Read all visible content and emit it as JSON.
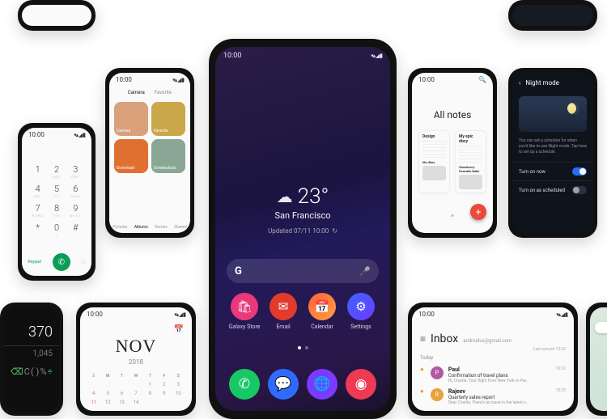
{
  "status_time": "10:00",
  "signal_glyph": "▾▴ ◢ ▮",
  "main": {
    "weather": {
      "icon": "☁",
      "temp": "23°",
      "city": "San Francisco",
      "updated_label": "Updated 07/11 10:00",
      "refresh_glyph": "↻"
    },
    "search": {
      "logo": "G",
      "mic_glyph": "🎤"
    },
    "apps": [
      {
        "label": "Galaxy Store",
        "glyph": "🛍",
        "bg": "#e9397a"
      },
      {
        "label": "Email",
        "glyph": "✉",
        "bg": "#e23b2e"
      },
      {
        "label": "Calendar",
        "glyph": "📅",
        "bg": "#ff5f3e,#ffa040"
      },
      {
        "label": "Settings",
        "glyph": "⚙",
        "bg": "#3a66ff,#6e3bff"
      }
    ],
    "dock": [
      {
        "name": "phone-icon",
        "glyph": "✆",
        "bg": "#17c964"
      },
      {
        "name": "messages-icon",
        "glyph": "💬",
        "bg": "#2f6bff"
      },
      {
        "name": "browser-icon",
        "glyph": "🌐",
        "bg": "#7a3bff"
      },
      {
        "name": "camera-icon",
        "glyph": "◉",
        "bg": "#ef3a55"
      }
    ]
  },
  "gallery": {
    "categories": [
      "Camera",
      "Favorite"
    ],
    "row2": [
      "Download",
      "Screenshots"
    ],
    "tabs": [
      "Pictures",
      "Albums",
      "Stories",
      "Shared"
    ],
    "colors": [
      "#d9a07a",
      "#caa84a",
      "#e07030",
      "#8aa796"
    ]
  },
  "dialer": {
    "keys": [
      {
        "n": "1",
        "s": ""
      },
      {
        "n": "2",
        "s": "ABC"
      },
      {
        "n": "3",
        "s": "DEF"
      },
      {
        "n": "4",
        "s": "GHI"
      },
      {
        "n": "5",
        "s": "JKL"
      },
      {
        "n": "6",
        "s": "MNO"
      },
      {
        "n": "7",
        "s": "PQRS"
      },
      {
        "n": "8",
        "s": "TUV"
      },
      {
        "n": "9",
        "s": "WXYZ"
      },
      {
        "n": "*",
        "s": ""
      },
      {
        "n": "0",
        "s": "+"
      },
      {
        "n": "#",
        "s": ""
      }
    ],
    "keypad_label": "Keypad",
    "call_glyph": "✆",
    "video_glyph": "▢"
  },
  "calculator": {
    "value": "370",
    "subvalue": "1,045",
    "ops": [
      "⌫",
      "C",
      "( )",
      "%",
      "÷"
    ]
  },
  "calendar": {
    "month": "NOV",
    "year": "2018",
    "icon": "📅",
    "dow": [
      "S",
      "M",
      "T",
      "W",
      "T",
      "F",
      "S"
    ],
    "dates": [
      "",
      "",
      "",
      "",
      "1",
      "2",
      "3",
      "4",
      "5",
      "6",
      "7",
      "8",
      "9",
      "10",
      "11",
      "12",
      "13",
      "14"
    ]
  },
  "notes": {
    "title": "All notes",
    "btn_glyph": "+",
    "search_glyph": "🔍",
    "cards": [
      {
        "title": "Design",
        "caption": "My diary"
      },
      {
        "title": "My epic diary",
        "caption": "Strawberry Pancake Bake"
      }
    ]
  },
  "night": {
    "back_glyph": "‹",
    "title": "Night mode",
    "desc": "You can set a schedule for when you'd like to use Night mode. Tap here to set up a schedule.",
    "rows": [
      {
        "label": "Turn on now",
        "on": true
      },
      {
        "label": "Turn on as scheduled",
        "on": false
      }
    ]
  },
  "inbox": {
    "menu_glyph": "≡",
    "title": "Inbox",
    "account": "androidux@gmail.com",
    "sync": "Last synced 10:32",
    "section": "Today",
    "mails": [
      {
        "from": "Paul",
        "subj": "Confirmation of travel plans",
        "prev": "Hi, Charlie. Your flight from New York to Par...",
        "time": "10:32",
        "avatar": "#b05aa0",
        "initial": "P",
        "unread": true
      },
      {
        "from": "Rajeev",
        "subj": "Quarterly sales report",
        "prev": "Dear Charlie, There's an issue in the latest n...",
        "time": "10:29",
        "avatar": "#e7a23a",
        "initial": "R",
        "unread": true
      }
    ]
  }
}
